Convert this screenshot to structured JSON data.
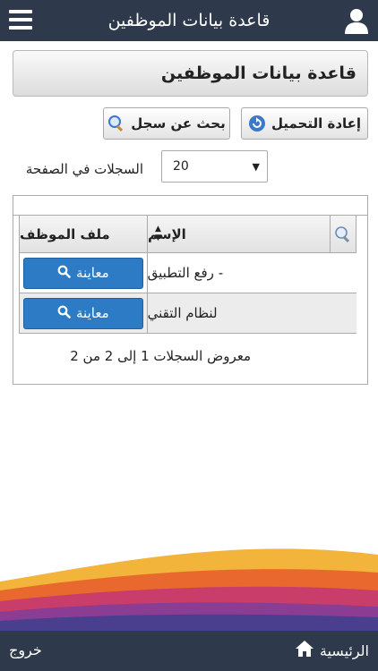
{
  "app": {
    "title": "قاعدة بيانات الموظفين"
  },
  "page": {
    "header": "قاعدة بيانات الموظفين"
  },
  "toolbar": {
    "reload_label": "إعادة التحميل",
    "search_label": "بحث عن سجل"
  },
  "pagesize": {
    "label": "السجلات في الصفحة",
    "value": "20"
  },
  "table": {
    "columns": {
      "file": "ملف الموظف",
      "name": "الإسم"
    },
    "rows": [
      {
        "name": "- رفع التطبيق",
        "action": "معاينة"
      },
      {
        "name": "لنظام التقني",
        "action": "معاينة"
      }
    ],
    "footer": "معروض السجلات 1 إلى 2 من 2"
  },
  "bottom": {
    "home": "الرئيسية",
    "logout": "خروج"
  },
  "colors": {
    "bar": "#2e3a4b",
    "button_blue": "#2d7bc4"
  },
  "icons": [
    "menu-icon",
    "user-icon",
    "reload-icon",
    "magnifier-icon",
    "search-icon",
    "home-icon"
  ]
}
